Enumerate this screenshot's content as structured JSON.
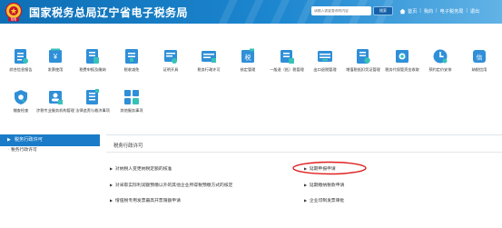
{
  "header": {
    "emblem_text": "税收",
    "title": "国家税务总局辽宁省电子税务局",
    "search_placeholder": "请输入需要查询的内容",
    "search_button": "搜索",
    "links": [
      "首页",
      "我的",
      "电子税务局",
      "退出"
    ]
  },
  "services": [
    {
      "label": "综合信息报告",
      "icon": "info-report-icon"
    },
    {
      "label": "发票使用",
      "icon": "invoice-use-icon"
    },
    {
      "label": "税费申报及缴纳",
      "icon": "tax-declare-icon"
    },
    {
      "label": "税收减免",
      "icon": "tax-relief-icon"
    },
    {
      "label": "证明开具",
      "icon": "certificate-icon"
    },
    {
      "label": "税务行政许可",
      "icon": "admin-permit-icon"
    },
    {
      "label": "核定管理",
      "icon": "assessment-icon"
    },
    {
      "label": "一般退（抵）税管理",
      "icon": "refund-icon"
    },
    {
      "label": "出口退税管理",
      "icon": "export-refund-icon"
    },
    {
      "label": "增值税抵扣凭证管理",
      "icon": "vat-voucher-icon"
    },
    {
      "label": "税务代保管资金收取",
      "icon": "escrow-fund-icon"
    },
    {
      "label": "预约定价安排",
      "icon": "pricing-icon"
    },
    {
      "label": "纳税信用",
      "icon": "credit-icon"
    },
    {
      "label": "稽查检查",
      "icon": "inspection-icon"
    },
    {
      "label": "涉税专业服务机构管理",
      "icon": "agency-icon"
    },
    {
      "label": "法律追责与救济事项",
      "icon": "legal-icon"
    },
    {
      "label": "其他服务事项",
      "icon": "other-service-icon"
    }
  ],
  "sidebar": {
    "header": "税务行政许可",
    "items": [
      "税务行政许可"
    ]
  },
  "main": {
    "title": "税务行政许可",
    "links": [
      "对纳税人变更纳税定额的核准",
      "对采取实际利润额预缴以外的其他企业所得税预缴方式的核定",
      "增值税专用发票最高开票限额申请",
      "延期申报申请",
      "延期缴纳税款申请",
      "企业印制发票审批"
    ]
  },
  "colors": {
    "header_blue": "#0e6fb5",
    "accent_blue": "#1a7cc8",
    "highlight_red": "#e02020"
  }
}
